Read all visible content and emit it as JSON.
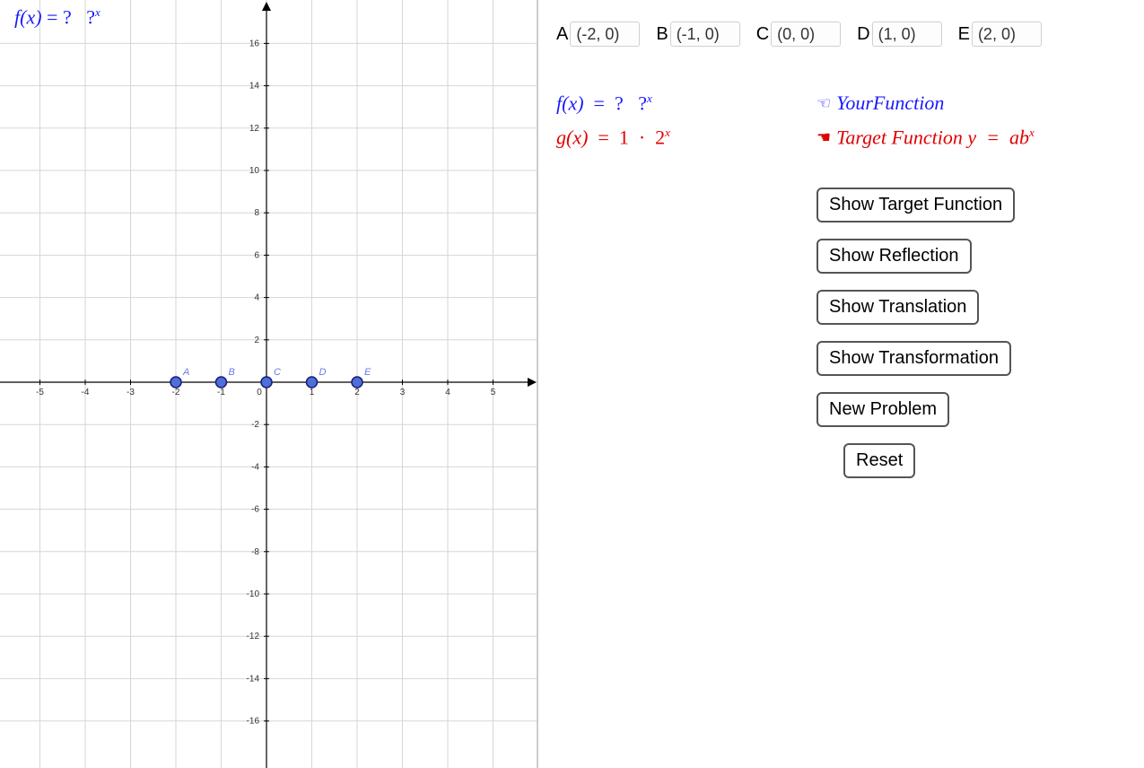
{
  "chart_data": {
    "type": "scatter",
    "title": "",
    "xlabel": "",
    "ylabel": "",
    "xlim": [
      -5,
      5
    ],
    "ylim": [
      -16,
      16
    ],
    "x_ticks": [
      -5,
      -4,
      -3,
      -2,
      -1,
      1,
      2,
      3,
      4,
      5
    ],
    "y_ticks": [
      -16,
      -14,
      -12,
      -10,
      -8,
      -6,
      -4,
      -2,
      2,
      4,
      6,
      8,
      10,
      12,
      14,
      16
    ],
    "grid": true,
    "series": [
      {
        "name": "points",
        "data": [
          {
            "label": "A",
            "x": -2,
            "y": 0
          },
          {
            "label": "B",
            "x": -1,
            "y": 0
          },
          {
            "label": "C",
            "x": 0,
            "y": 0
          },
          {
            "label": "D",
            "x": 1,
            "y": 0
          },
          {
            "label": "E",
            "x": 2,
            "y": 0
          }
        ]
      }
    ],
    "origin_label": "0"
  },
  "overlay_formula": {
    "lhs": "f(x)",
    "eq": "=",
    "rhs_a": "?",
    "rhs_b": "?",
    "rhs_exp": "x"
  },
  "points_inputs": [
    {
      "label": "A",
      "value": "(-2, 0)"
    },
    {
      "label": "B",
      "value": "(-1, 0)"
    },
    {
      "label": "C",
      "value": "(0, 0)"
    },
    {
      "label": "D",
      "value": "(1, 0)"
    },
    {
      "label": "E",
      "value": "(2, 0)"
    }
  ],
  "formulas": {
    "f": {
      "lhs": "f(x)",
      "eq": "=",
      "a": "?",
      "b": "?",
      "exp": "x"
    },
    "g": {
      "lhs": "g(x)",
      "eq": "=",
      "a": "1",
      "dot": "·",
      "b": "2",
      "exp": "x"
    }
  },
  "legend": {
    "your_function": "YourFunction",
    "target_prefix": "Target Function ",
    "target_eq_lhs": "y",
    "target_eq_eq": "=",
    "target_eq_a": "a",
    "target_eq_b": "b",
    "target_eq_exp": "x"
  },
  "buttons": {
    "show_target": "Show Target Function",
    "show_reflection": "Show Reflection",
    "show_translation": "Show Translation",
    "show_transformation": "Show Transformation",
    "new_problem": "New Problem",
    "reset": "Reset"
  },
  "colors": {
    "blue": "#1a1aff",
    "red": "#e00000",
    "grid": "#d6d6d6",
    "axis": "#000",
    "point_fill": "#4d6fd6",
    "point_stroke": "#1a1a7a",
    "point_label": "#6a7ae6"
  }
}
